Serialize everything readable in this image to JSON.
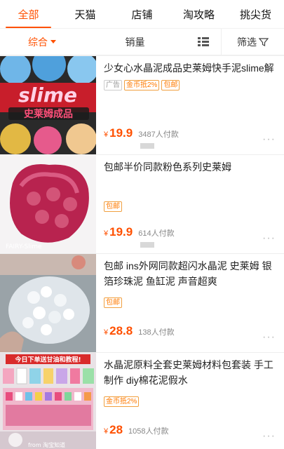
{
  "tabs": [
    {
      "label": "全部"
    },
    {
      "label": "天猫"
    },
    {
      "label": "店铺"
    },
    {
      "label": "淘攻略"
    },
    {
      "label": "挑尖货"
    }
  ],
  "filters": {
    "sort_label": "综合",
    "sales_label": "销量",
    "filter_label": "筛选"
  },
  "thumb_text": {
    "item1_slime": "slime",
    "item1_cn": "史莱姆成品",
    "item2_watermark": "FAIRY-Slime",
    "item4_banner": "今日下单送甘油和教程!",
    "item4_watermark": "from 淘宝知道"
  },
  "items": [
    {
      "title": "少女心水晶泥成品史莱姆快手泥slime解",
      "tags": [
        "广告",
        "金币抵2%",
        "包邮"
      ],
      "price": "19.9",
      "sold": "3487人付款"
    },
    {
      "title": "包邮半价同款粉色系列史莱姆",
      "tags": [
        "包邮"
      ],
      "price": "19.9",
      "sold": "614人付款"
    },
    {
      "title": "包邮 ins外网同款超闪水晶泥 史莱姆 银箔珍珠泥 鱼缸泥 声音超爽",
      "tags": [
        "包邮"
      ],
      "price": "28.8",
      "sold": "138人付款"
    },
    {
      "title": "水晶泥原料全套史莱姆材料包套装 手工制作 diy棉花泥假水",
      "tags": [
        "金币抵2%"
      ],
      "price": "28",
      "sold": "1058人付款"
    }
  ],
  "currency": "¥",
  "more_glyph": "···"
}
